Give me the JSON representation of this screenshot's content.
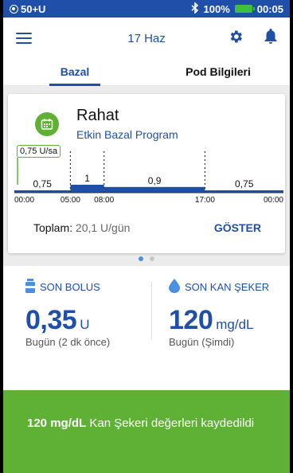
{
  "status_bar": {
    "pod_label": "50+U",
    "battery_text": "100%",
    "time": "00:05"
  },
  "header": {
    "date": "17 Haz"
  },
  "tabs": [
    {
      "label": "Bazal",
      "active": true
    },
    {
      "label": "Pod Bilgileri",
      "active": false
    }
  ],
  "basal_card": {
    "program_name": "Rahat",
    "program_subtitle": "Etkin Bazal Program",
    "current_rate": "0,75 U/sa",
    "segments": [
      {
        "start": "00:00",
        "end": "05:00",
        "rate_label": "0,75",
        "rate": 0.75
      },
      {
        "start": "05:00",
        "end": "08:00",
        "rate_label": "1",
        "rate": 1.0
      },
      {
        "start": "08:00",
        "end": "17:00",
        "rate_label": "0,9",
        "rate": 0.9
      },
      {
        "start": "17:00",
        "end": "00:00",
        "rate_label": "0,75",
        "rate": 0.75
      }
    ],
    "time_ticks": [
      "00:00",
      "05:00",
      "08:00",
      "17:00",
      "00:00"
    ],
    "total_label": "Toplam:",
    "total_value": "20,1 U/gün",
    "show_button": "GÖSTER"
  },
  "pager": {
    "count": 2,
    "active": 0
  },
  "last_bolus": {
    "title": "SON BOLUS",
    "value": "0,35",
    "unit": "U",
    "when": "Bugün (2 dk önce)"
  },
  "last_bg": {
    "title": "SON KAN ŞEKER",
    "value": "120",
    "unit": "mg/dL",
    "when": "Bugün (Şimdi)"
  },
  "banner": {
    "bold_text": "120 mg/dL",
    "text": " Kan Şekeri değerleri kaydedildi"
  },
  "colors": {
    "primary_blue": "#1f4fa8",
    "accent_green": "#5fb135",
    "chart_blue": "#1f4fa8"
  }
}
